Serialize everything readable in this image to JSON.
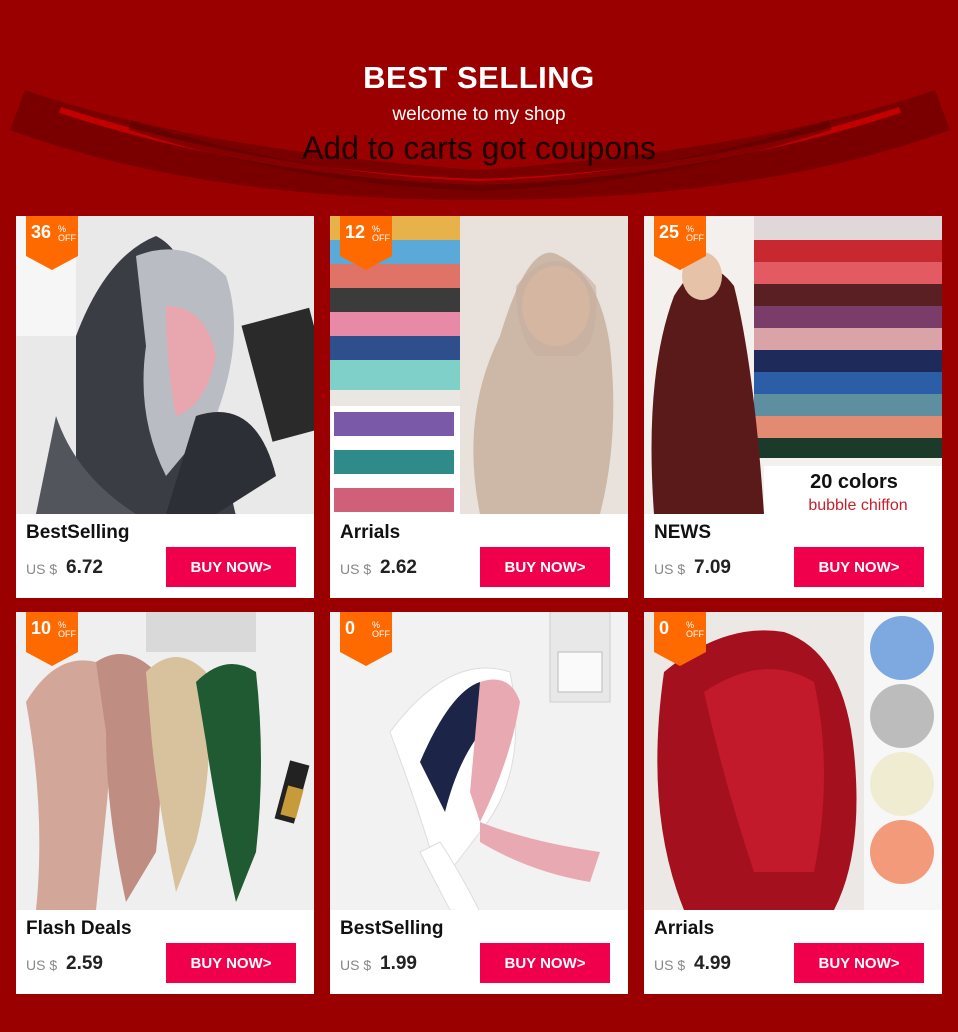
{
  "header": {
    "title": "BEST SELLING",
    "subtitle": "welcome to my shop",
    "tagline": "Add to carts got coupons"
  },
  "colors": {
    "background": "#9a0000",
    "badge": "#ff6a00",
    "button": "#f0004c"
  },
  "products": [
    {
      "discount": "36",
      "name": "BestSelling",
      "currency": "US $",
      "price": "6.72",
      "button": "BUY NOW>"
    },
    {
      "discount": "12",
      "name": "Arrials",
      "currency": "US $",
      "price": "2.62",
      "button": "BUY NOW>"
    },
    {
      "discount": "25",
      "name": "NEWS",
      "currency": "US $",
      "price": "7.09",
      "button": "BUY NOW>",
      "image_text_1": "20 colors",
      "image_text_2": "bubble chiffon"
    },
    {
      "discount": "10",
      "name": "Flash Deals",
      "currency": "US $",
      "price": "2.59",
      "button": "BUY NOW>"
    },
    {
      "discount": "0",
      "name": "BestSelling",
      "currency": "US $",
      "price": "1.99",
      "button": "BUY NOW>"
    },
    {
      "discount": "0",
      "name": "Arrials",
      "currency": "US $",
      "price": "4.99",
      "button": "BUY NOW>"
    }
  ],
  "badge_labels": {
    "percent": "%",
    "off": "OFF"
  }
}
